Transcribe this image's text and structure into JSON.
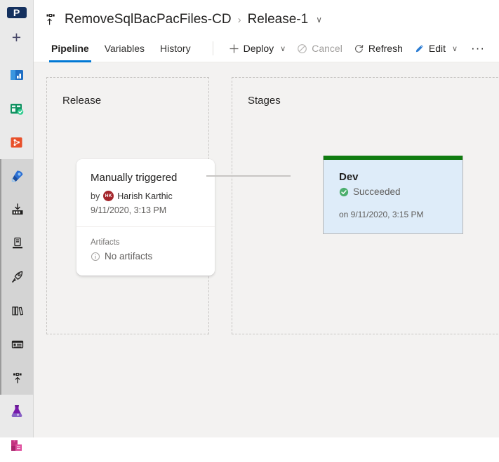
{
  "rail": {
    "project_initial": "P",
    "new_label": "+",
    "items": [
      {
        "name": "overview-icon",
        "label": "Overview"
      },
      {
        "name": "boards-icon",
        "label": "Boards"
      },
      {
        "name": "repos-icon",
        "label": "Repos"
      },
      {
        "name": "pipelines-icon",
        "label": "Pipelines"
      },
      {
        "name": "builds-icon",
        "label": "Builds"
      },
      {
        "name": "environments-icon",
        "label": "Environments"
      },
      {
        "name": "releases-rocket-icon",
        "label": "Releases"
      },
      {
        "name": "library-icon",
        "label": "Library"
      },
      {
        "name": "task-groups-icon",
        "label": "Task groups"
      },
      {
        "name": "deployment-groups-icon",
        "label": "Deployment groups"
      },
      {
        "name": "test-plans-icon",
        "label": "Test Plans"
      },
      {
        "name": "artifacts-icon",
        "label": "Artifacts"
      }
    ]
  },
  "header": {
    "pipeline_name": "RemoveSqlBacPacFiles-CD",
    "separator": "›",
    "release_name": "Release-1",
    "release_chevron": "∨",
    "pipeline_icon": "release-pipeline-icon"
  },
  "tabs": [
    {
      "label": "Pipeline",
      "active": true
    },
    {
      "label": "Variables",
      "active": false
    },
    {
      "label": "History",
      "active": false
    }
  ],
  "toolbar": {
    "deploy_label": "Deploy",
    "deploy_chevron": "∨",
    "cancel_label": "Cancel",
    "refresh_label": "Refresh",
    "edit_label": "Edit",
    "edit_chevron": "∨",
    "more_label": "···"
  },
  "canvas": {
    "release_panel_title": "Release",
    "stages_panel_title": "Stages"
  },
  "release_card": {
    "title": "Manually triggered",
    "by_word": "by",
    "author": "Harish Karthic",
    "author_initials": "HK",
    "date": "9/11/2020, 3:13 PM",
    "artifacts_label": "Artifacts",
    "no_artifacts": "No artifacts"
  },
  "stage_card": {
    "name": "Dev",
    "status": "Succeeded",
    "date": "on 9/11/2020, 3:15 PM"
  },
  "colors": {
    "accent": "#0078d4",
    "success": "#107c10",
    "selected_card": "#deecf9",
    "avatar": "#a4262c",
    "canvas": "#f3f2f1"
  }
}
